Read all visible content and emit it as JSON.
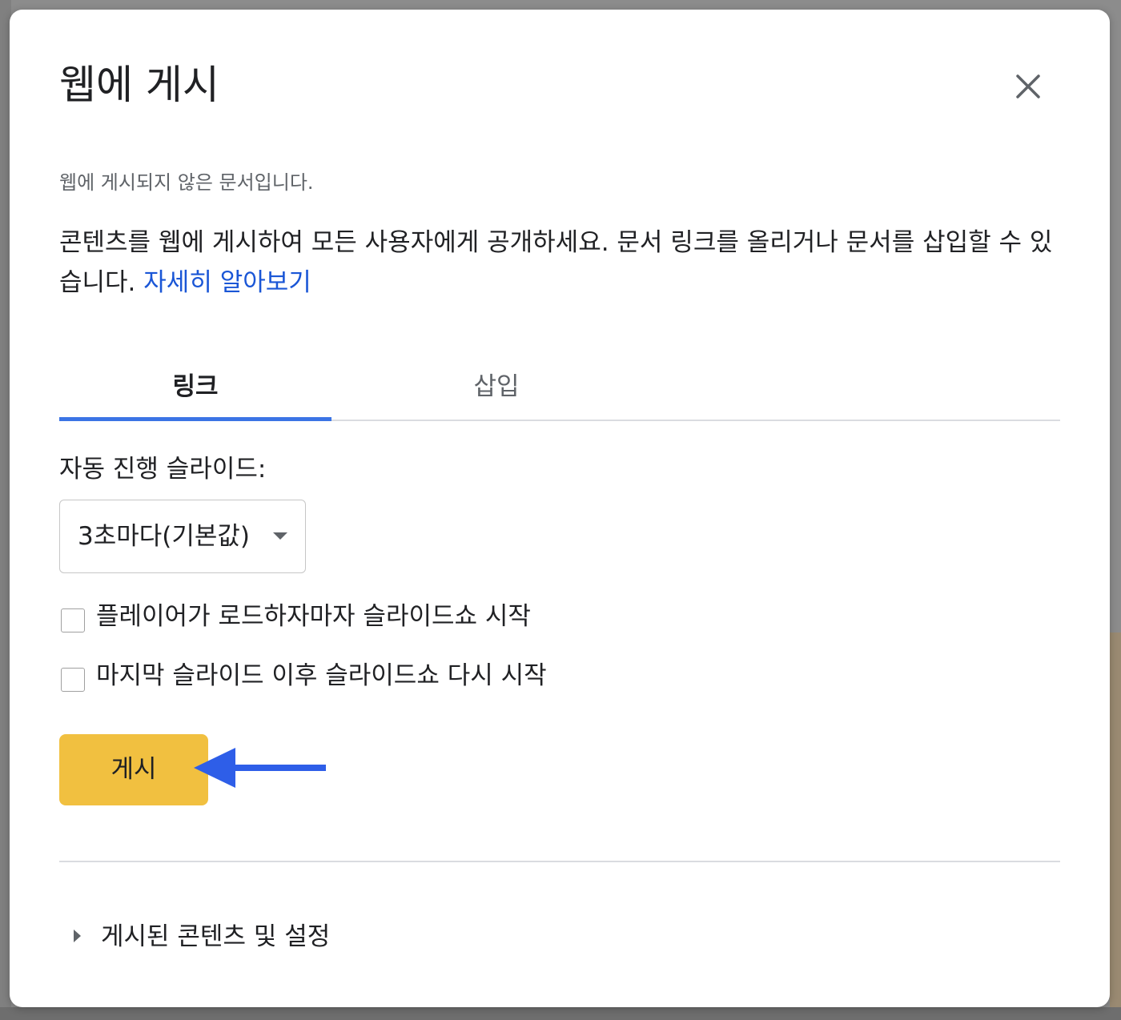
{
  "dialog": {
    "title": "웹에 게시",
    "close_icon": "close-icon",
    "status": "웹에 게시되지 않은 문서입니다.",
    "description": "콘텐츠를 웹에 게시하여 모든 사용자에게 공개하세요. 문서 링크를 올리거나 문서를 삽입할 수 있습니다. ",
    "learn_more": "자세히 알아보기"
  },
  "tabs": [
    {
      "label": "링크",
      "active": true
    },
    {
      "label": "삽입",
      "active": false
    }
  ],
  "auto_advance": {
    "label": "자동 진행 슬라이드:",
    "selected": "3초마다(기본값)"
  },
  "options": [
    {
      "label": "플레이어가 로드하자마자 슬라이드쇼 시작",
      "checked": false
    },
    {
      "label": "마지막 슬라이드 이후 슬라이드쇼 다시 시작",
      "checked": false
    }
  ],
  "publish_button": "게시",
  "published_settings": "게시된 콘텐츠 및 설정",
  "colors": {
    "accent_blue": "#3b74e5",
    "link_blue": "#1a56d6",
    "publish_yellow": "#f1c040",
    "annotation_arrow": "#2e5ee8"
  }
}
